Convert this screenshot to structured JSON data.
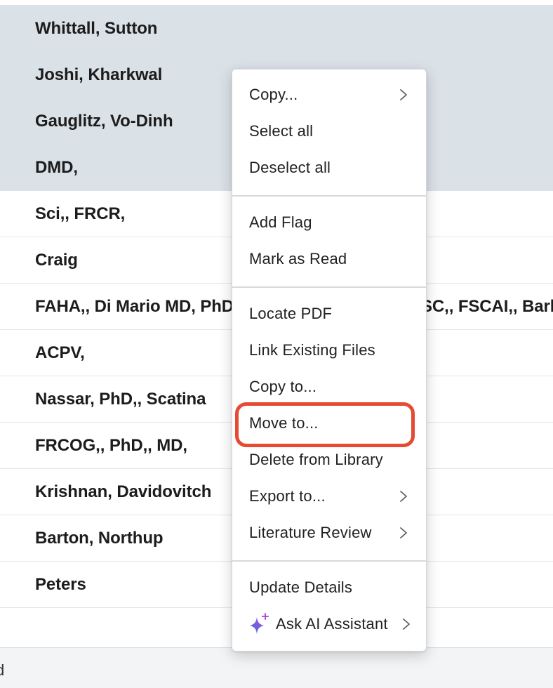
{
  "table": {
    "rows": [
      {
        "text": "Whittall, Sutton",
        "selected": true
      },
      {
        "text": "Joshi, Kharkwal",
        "selected": true
      },
      {
        "text": "Gauglitz, Vo-Dinh",
        "selected": true
      },
      {
        "text": "DMD,",
        "selected": true
      },
      {
        "text": "Sci,, FRCR,",
        "selected": false
      },
      {
        "text": "Craig",
        "selected": false
      },
      {
        "text": "FAHA,, Di Mario MD, PhD",
        "text_right": "SC,, FSCAI,, Barl",
        "selected": false
      },
      {
        "text": "ACPV,",
        "selected": false
      },
      {
        "text": "Nassar, PhD,, Scatina",
        "selected": false
      },
      {
        "text": "FRCOG,, PhD,, MD,",
        "selected": false
      },
      {
        "text": "Krishnan, Davidovitch",
        "selected": false
      },
      {
        "text": "Barton, Northup",
        "selected": false
      },
      {
        "text": "Peters",
        "selected": false
      },
      {
        "text": "",
        "selected": false
      }
    ],
    "footer_text": "d"
  },
  "context_menu": {
    "groups": [
      [
        {
          "label": "Copy...",
          "submenu": true
        },
        {
          "label": "Select all",
          "submenu": false
        },
        {
          "label": "Deselect all",
          "submenu": false
        }
      ],
      [
        {
          "label": "Add Flag",
          "submenu": false
        },
        {
          "label": "Mark as Read",
          "submenu": false
        }
      ],
      [
        {
          "label": "Locate PDF",
          "submenu": false
        },
        {
          "label": "Link Existing Files",
          "submenu": false
        },
        {
          "label": "Copy to...",
          "submenu": false
        },
        {
          "label": "Move to...",
          "submenu": false,
          "highlighted": true
        },
        {
          "label": "Delete from Library",
          "submenu": false
        },
        {
          "label": "Export to...",
          "submenu": true
        },
        {
          "label": "Literature Review",
          "submenu": true
        }
      ],
      [
        {
          "label": "Update Details",
          "submenu": false
        },
        {
          "label": "Ask AI Assistant",
          "submenu": true,
          "icon": "sparkle-icon"
        }
      ]
    ]
  },
  "colors": {
    "selected_row": "#dae1e7",
    "highlight_ring": "#e54b32",
    "ai_sparkle_start": "#3b6fe0",
    "ai_sparkle_end": "#b04fd8"
  }
}
